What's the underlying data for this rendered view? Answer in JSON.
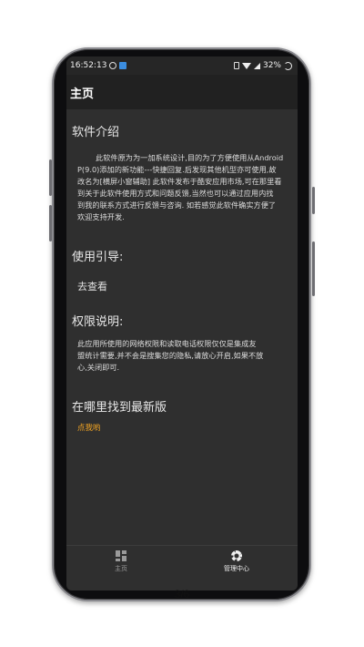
{
  "status": {
    "time": "16:52:13",
    "battery": "32%"
  },
  "appbar": {
    "title": "主页"
  },
  "sections": {
    "intro": {
      "title": "软件介绍",
      "lines": [
        "此软件原为为一加系统设计,目的为了方便使用从Android",
        "P(9.0)添加的新功能---快捷回复.后发现其他机型亦可使用,故",
        "改名为[横屏小窗辅助] 此软件发布于酷安应用市场,可在那里看",
        "到关于此软件使用方式和问题反馈,当然也可以通过应用内找",
        "到我的联系方式进行反馈与咨询. 如若感觉此软件确实方便了",
        "欢迎支持开发."
      ]
    },
    "guide": {
      "title": "使用引导:",
      "link": "去查看"
    },
    "permissions": {
      "title": "权限说明:",
      "lines": [
        "此应用所使用的网络权限和读取电话权限仅仅是集成友",
        "盟统计需要,并不会是搜集您的隐私,请放心开启,如果不放",
        "心,关闭即可."
      ]
    },
    "latest": {
      "title": "在哪里找到最新版",
      "link": "点我哟"
    }
  },
  "bottom_nav": {
    "home": "主页",
    "settings": "管理中心"
  },
  "pager": "3/6",
  "colors": {
    "accent": "#f5a623",
    "background": "#2f2f2f",
    "appbar": "#212121"
  }
}
